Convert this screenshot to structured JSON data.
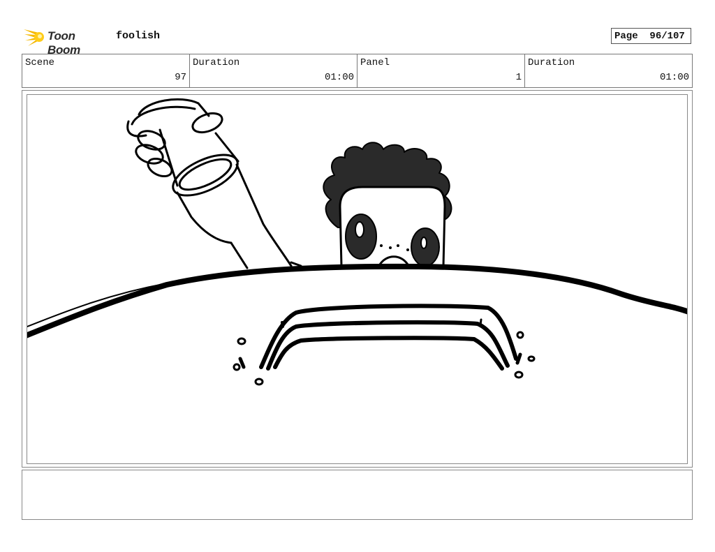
{
  "header": {
    "logo_text": "Toon Boom",
    "project_name": "foolish",
    "page_label": "Page",
    "page_number": "96/107"
  },
  "info": {
    "scene_label": "Scene",
    "scene_value": "97",
    "scene_duration_label": "Duration",
    "scene_duration_value": "01:00",
    "panel_label": "Panel",
    "panel_value": "1",
    "panel_duration_label": "Duration",
    "panel_duration_value": "01:00"
  },
  "notes": {
    "text": ""
  }
}
